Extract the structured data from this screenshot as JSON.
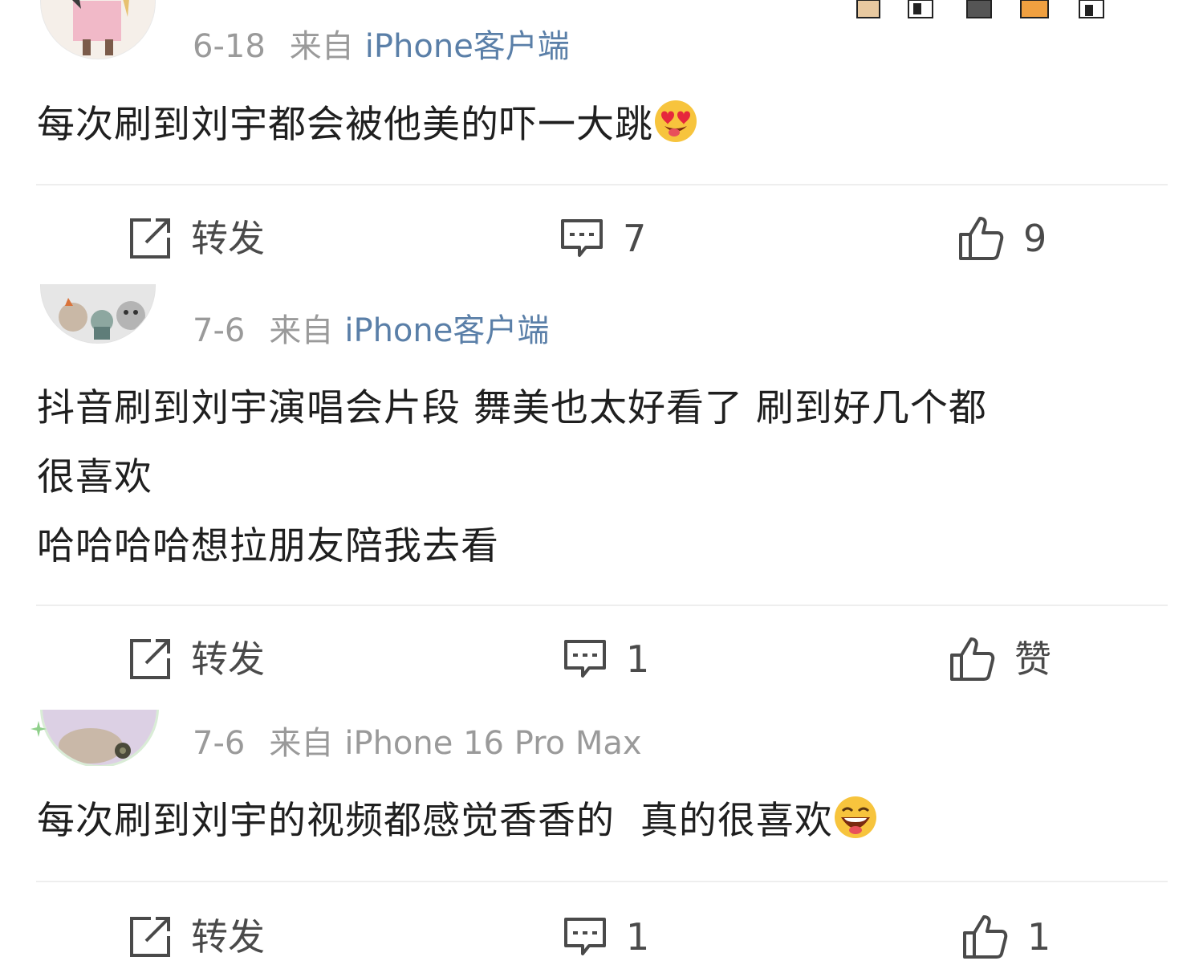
{
  "posts": [
    {
      "date": "6-18",
      "from": "来自",
      "client": "iPhone客户端",
      "content": [
        "每次刷到刘宇都会被他美的吓一大跳"
      ],
      "emoji": "heart-eyes-emoji",
      "actions": {
        "repost": "转发",
        "comments": "7",
        "likes": "9"
      }
    },
    {
      "date": "7-6",
      "from": "来自",
      "client": "iPhone客户端",
      "content": [
        "抖音刷到刘宇演唱会片段 舞美也太好看了 刷到好几个都",
        "很喜欢",
        "哈哈哈哈想拉朋友陪我去看"
      ],
      "actions": {
        "repost": "转发",
        "comments": "1",
        "likes": "赞"
      }
    },
    {
      "date": "7-6",
      "from": "来自",
      "client": "iPhone 16 Pro Max",
      "content": [
        "每次刷到刘宇的视频都感觉香香的  真的很喜欢"
      ],
      "emoji": "laughing-emoji",
      "actions": {
        "repost": "转发",
        "comments": "1",
        "likes": "1"
      }
    }
  ],
  "colors": {
    "client_link": "#5a7fa8",
    "meta_gray": "#9a9a9a",
    "text": "#1f1f1f",
    "icon": "#4a4a4a",
    "divider": "#eeeeee"
  }
}
